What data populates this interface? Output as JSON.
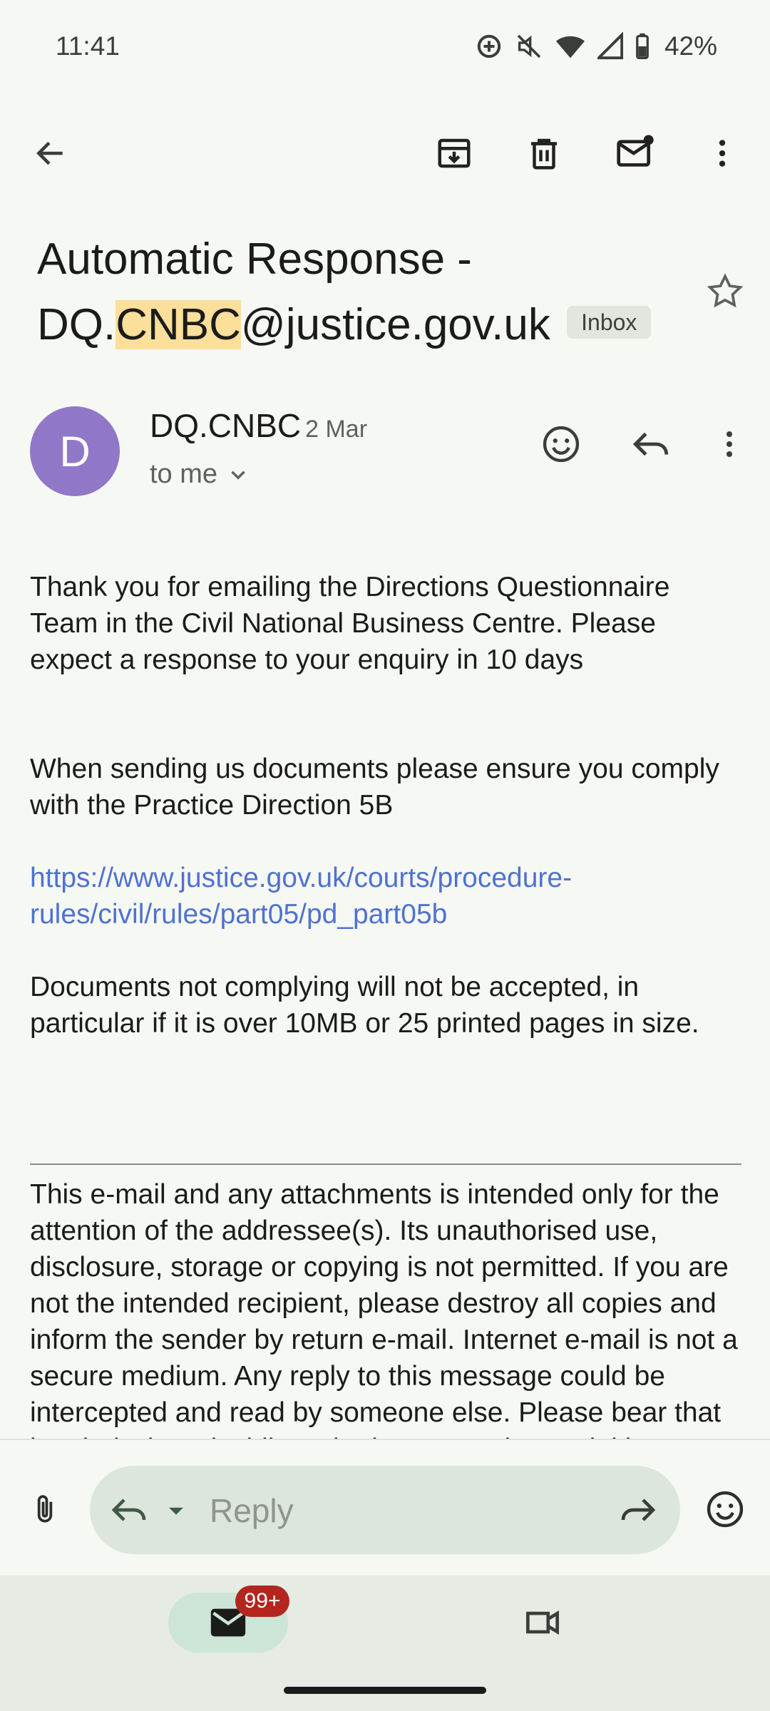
{
  "status_bar": {
    "time": "11:41",
    "battery": "42%"
  },
  "email": {
    "subject_before": "Automatic Response - DQ.",
    "subject_highlight": "CNBC",
    "subject_after": "@justice.gov.uk",
    "label_chip": "Inbox",
    "sender": {
      "initial": "D",
      "name": "DQ.CNBC",
      "date": "2 Mar",
      "recipient": "to me"
    },
    "body": {
      "para1": "Thank you for emailing the Directions Questionnaire Team in the Civil National Business Centre. Please expect a response to your enquiry in 10 days",
      "para2": "When sending us documents please ensure you comply with the Practice Direction 5B",
      "link": "https://www.justice.gov.uk/courts/procedure-rules/civil/rules/part05/pd_part05b",
      "para3": "Documents not complying will not be accepted, in particular if it is over 10MB or 25 printed pages in size.",
      "disclaimer": "This e-mail and any attachments is intended only for the attention of the addressee(s). Its unauthorised use, disclosure, storage or copying is not permitted. If you are not the intended recipient, please destroy all copies and inform the sender by return e-mail. Internet e-mail is not a secure medium. Any reply to this message could be intercepted and read by someone else. Please bear that in mind when deciding whether to send material in response to this message by e-mail."
    }
  },
  "reply_bar": {
    "placeholder": "Reply"
  },
  "bottom_nav": {
    "mail_badge": "99+"
  },
  "colors": {
    "accent": "#4f72d0",
    "avatar": "#9177c7",
    "highlight": "#fbdf9a",
    "badge": "#b3261e"
  },
  "icons": [
    "back-arrow-icon",
    "archive-icon",
    "delete-icon",
    "mark-unread-icon",
    "more-vert-icon",
    "star-icon",
    "emoji-icon",
    "reply-icon",
    "attachment-icon",
    "reply-icon",
    "dropdown-icon",
    "forward-icon",
    "mail-icon",
    "video-icon"
  ]
}
